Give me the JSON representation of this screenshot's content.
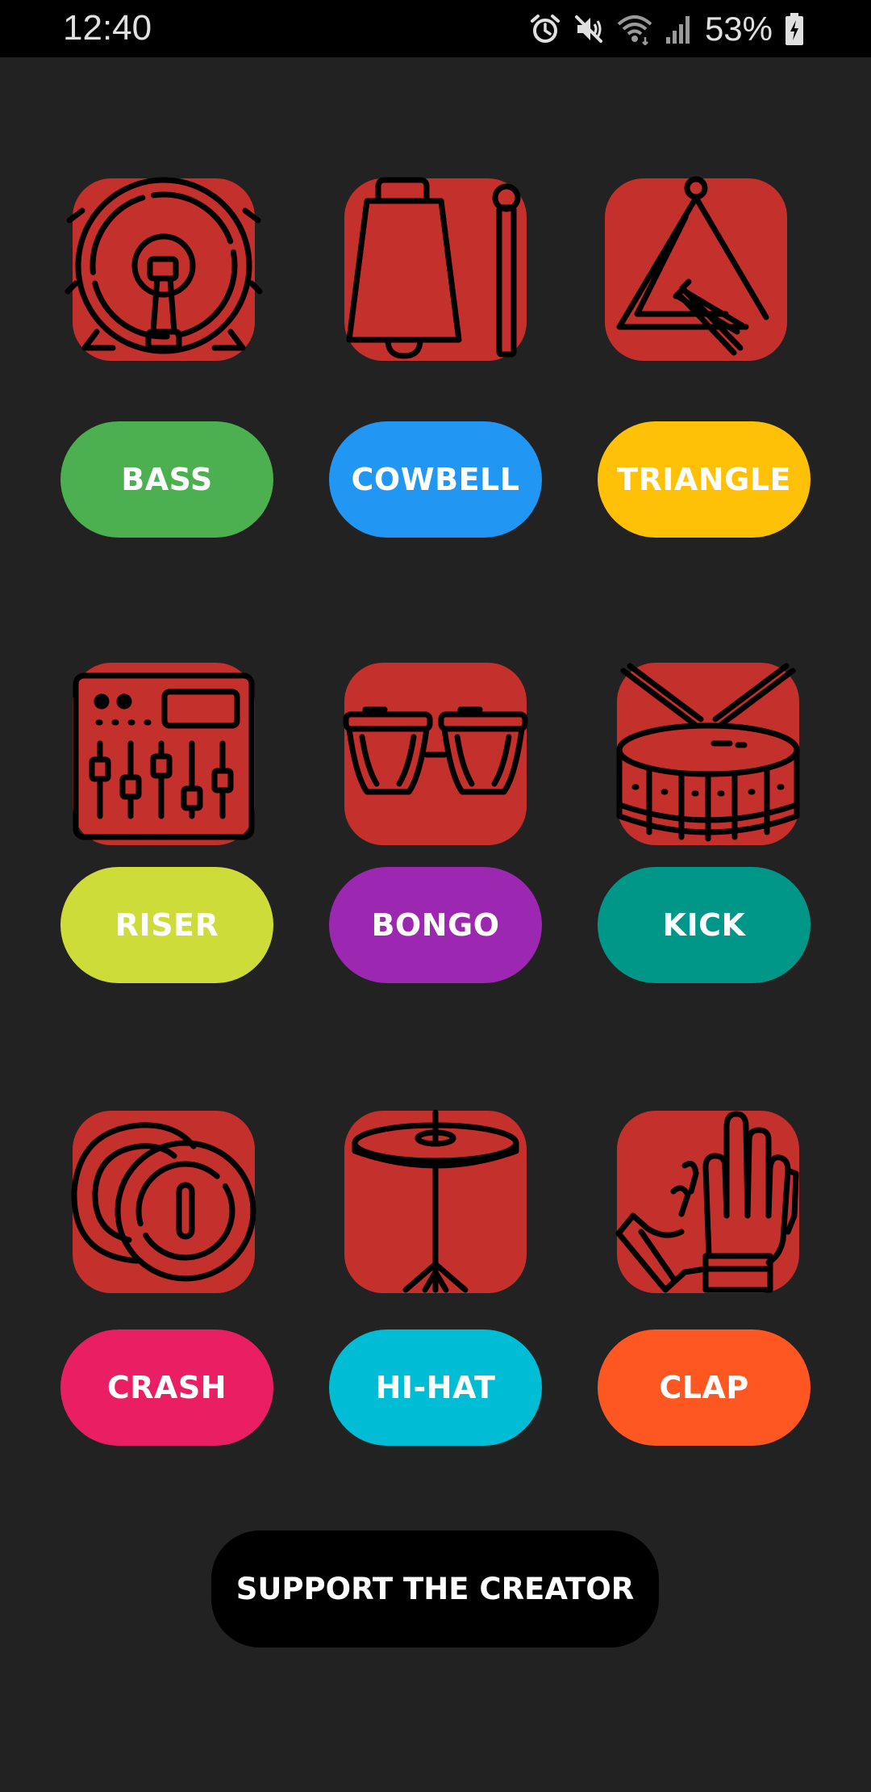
{
  "status_bar": {
    "time": "12:40",
    "battery_percent": "53%",
    "icons": [
      "alarm-icon",
      "mute-icon",
      "wifi-icon",
      "signal-icon",
      "battery-charging-icon"
    ]
  },
  "pads": [
    {
      "label": "BASS",
      "icon": "bass-drum-icon",
      "color": "#4caf50"
    },
    {
      "label": "COWBELL",
      "icon": "cowbell-icon",
      "color": "#2196f3"
    },
    {
      "label": "TRIANGLE",
      "icon": "triangle-icon",
      "color": "#ffc107"
    },
    {
      "label": "RISER",
      "icon": "mixer-icon",
      "color": "#cddc39"
    },
    {
      "label": "BONGO",
      "icon": "bongo-icon",
      "color": "#9c27b0"
    },
    {
      "label": "KICK",
      "icon": "snare-drum-icon",
      "color": "#009688"
    },
    {
      "label": "CRASH",
      "icon": "crash-cymbal-icon",
      "color": "#e91e63"
    },
    {
      "label": "HI-HAT",
      "icon": "hi-hat-icon",
      "color": "#00bcd4"
    },
    {
      "label": "CLAP",
      "icon": "clap-hands-icon",
      "color": "#ff5722"
    }
  ],
  "tile_color": "#c4302b",
  "support_button": {
    "label": "SUPPORT THE CREATOR",
    "color": "#000000"
  }
}
